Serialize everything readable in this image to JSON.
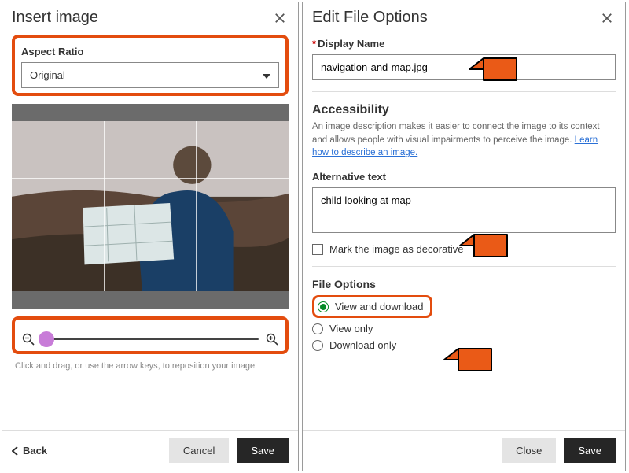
{
  "left": {
    "title": "Insert image",
    "aspect_label": "Aspect Ratio",
    "aspect_value": "Original",
    "helper": "Click and drag, or use the arrow keys, to reposition your image",
    "back": "Back",
    "cancel": "Cancel",
    "save": "Save"
  },
  "right": {
    "title": "Edit File Options",
    "display_name_label": "Display Name",
    "display_name_value": "navigation-and-map.jpg",
    "access_h": "Accessibility",
    "access_desc": "An image description makes it easier to connect the image to its context and allows people with visual impairments to perceive the image. ",
    "access_link": "Learn how to describe an image.",
    "alt_label": "Alternative text",
    "alt_value": "child looking at map",
    "decorative": "Mark the image as decorative",
    "file_opts_h": "File Options",
    "opt_view_dl": "View and download",
    "opt_view": "View only",
    "opt_dl": "Download only",
    "close": "Close",
    "save": "Save"
  }
}
